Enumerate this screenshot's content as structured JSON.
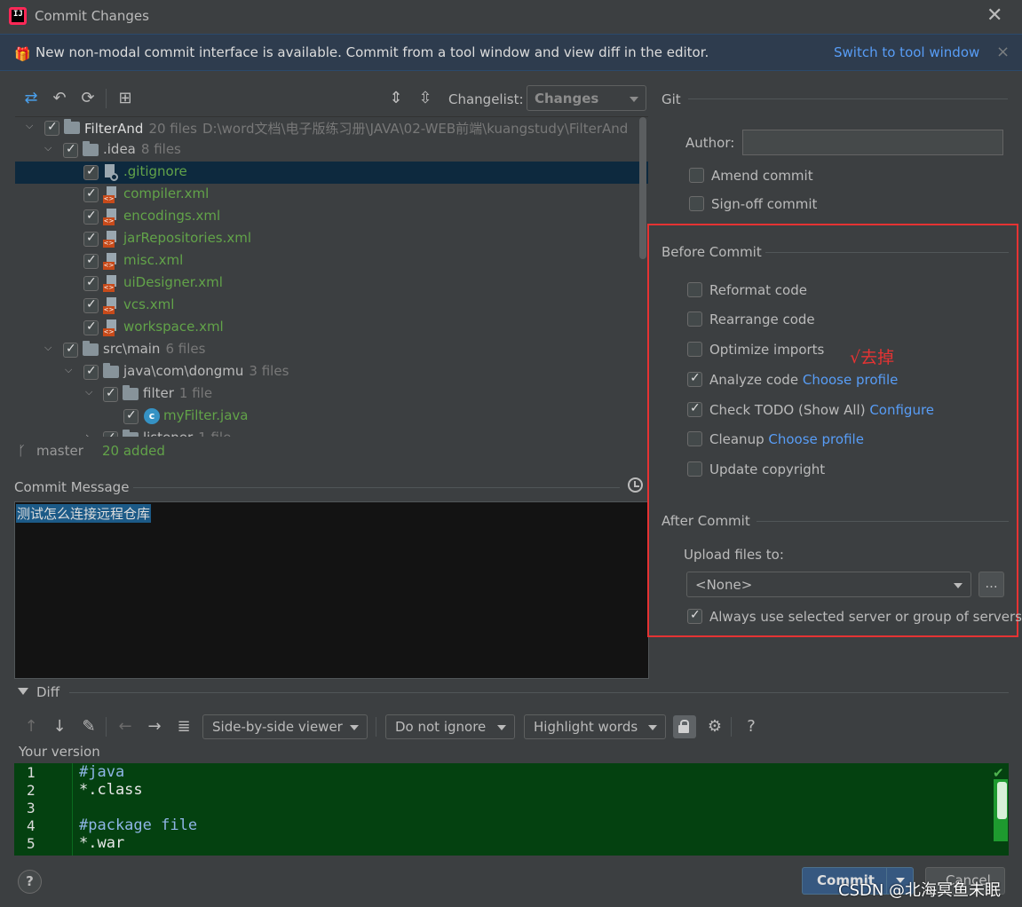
{
  "window": {
    "title": "Commit Changes",
    "close": "✕"
  },
  "banner": {
    "text": "New non-modal commit interface is available. Commit from a tool window and view diff in the editor.",
    "link": "Switch to tool window",
    "close": "×"
  },
  "toolbar": {
    "changelist_label": "Changelist:",
    "changelist_value": "Changes"
  },
  "tree": {
    "rows": [
      {
        "name": "FilterAnd",
        "count": "20 files",
        "path": "D:\\word文档\\电子版练习册\\JAVA\\02-WEB前端\\kuangstudy\\FilterAnd"
      },
      {
        "name": ".idea",
        "count": "8 files"
      },
      {
        "name": ".gitignore"
      },
      {
        "name": "compiler.xml"
      },
      {
        "name": "encodings.xml"
      },
      {
        "name": "jarRepositories.xml"
      },
      {
        "name": "misc.xml"
      },
      {
        "name": "uiDesigner.xml"
      },
      {
        "name": "vcs.xml"
      },
      {
        "name": "workspace.xml"
      },
      {
        "name": "src\\main",
        "count": "6 files"
      },
      {
        "name": "java\\com\\dongmu",
        "count": "3 files"
      },
      {
        "name": "filter",
        "count": "1 file"
      },
      {
        "name": "myFilter.java"
      },
      {
        "name": "listener",
        "count": "1 file"
      }
    ]
  },
  "status": {
    "branch": "master",
    "added": "20 added"
  },
  "commit_message": {
    "label": "Commit Message",
    "text": "测试怎么连接远程仓库"
  },
  "git": {
    "section": "Git",
    "author_label": "Author:",
    "author_value": "",
    "amend": "Amend commit",
    "signoff": "Sign-off commit"
  },
  "before_commit": {
    "title": "Before Commit",
    "reformat": "Reformat code",
    "rearrange": "Rearrange code",
    "optimize": "Optimize imports",
    "analyze": "Analyze code",
    "analyze_link": "Choose profile",
    "todo": "Check TODO (Show All)",
    "todo_link": "Configure",
    "cleanup": "Cleanup",
    "cleanup_link": "Choose profile",
    "copyright": "Update copyright",
    "annotation": "√去掉"
  },
  "after_commit": {
    "title": "After Commit",
    "upload_label": "Upload files to:",
    "upload_value": "<None>",
    "dots": "...",
    "always": "Always use selected server or group of servers"
  },
  "diff": {
    "label": "Diff",
    "viewer": "Side-by-side viewer",
    "ignore": "Do not ignore",
    "highlight": "Highlight words",
    "help": "?",
    "your_version": "Your version",
    "lines": [
      {
        "n": "1",
        "text": "#java",
        "kind": "comment"
      },
      {
        "n": "2",
        "text": "*.class",
        "kind": "plain"
      },
      {
        "n": "3",
        "text": "",
        "kind": "plain"
      },
      {
        "n": "4",
        "text": "#package file",
        "kind": "comment"
      },
      {
        "n": "5",
        "text": "*.war",
        "kind": "plain"
      }
    ]
  },
  "footer": {
    "help": "?",
    "commit": "Commit",
    "cancel": "Cancel",
    "watermark": "CSDN @北海冥鱼未眠"
  }
}
